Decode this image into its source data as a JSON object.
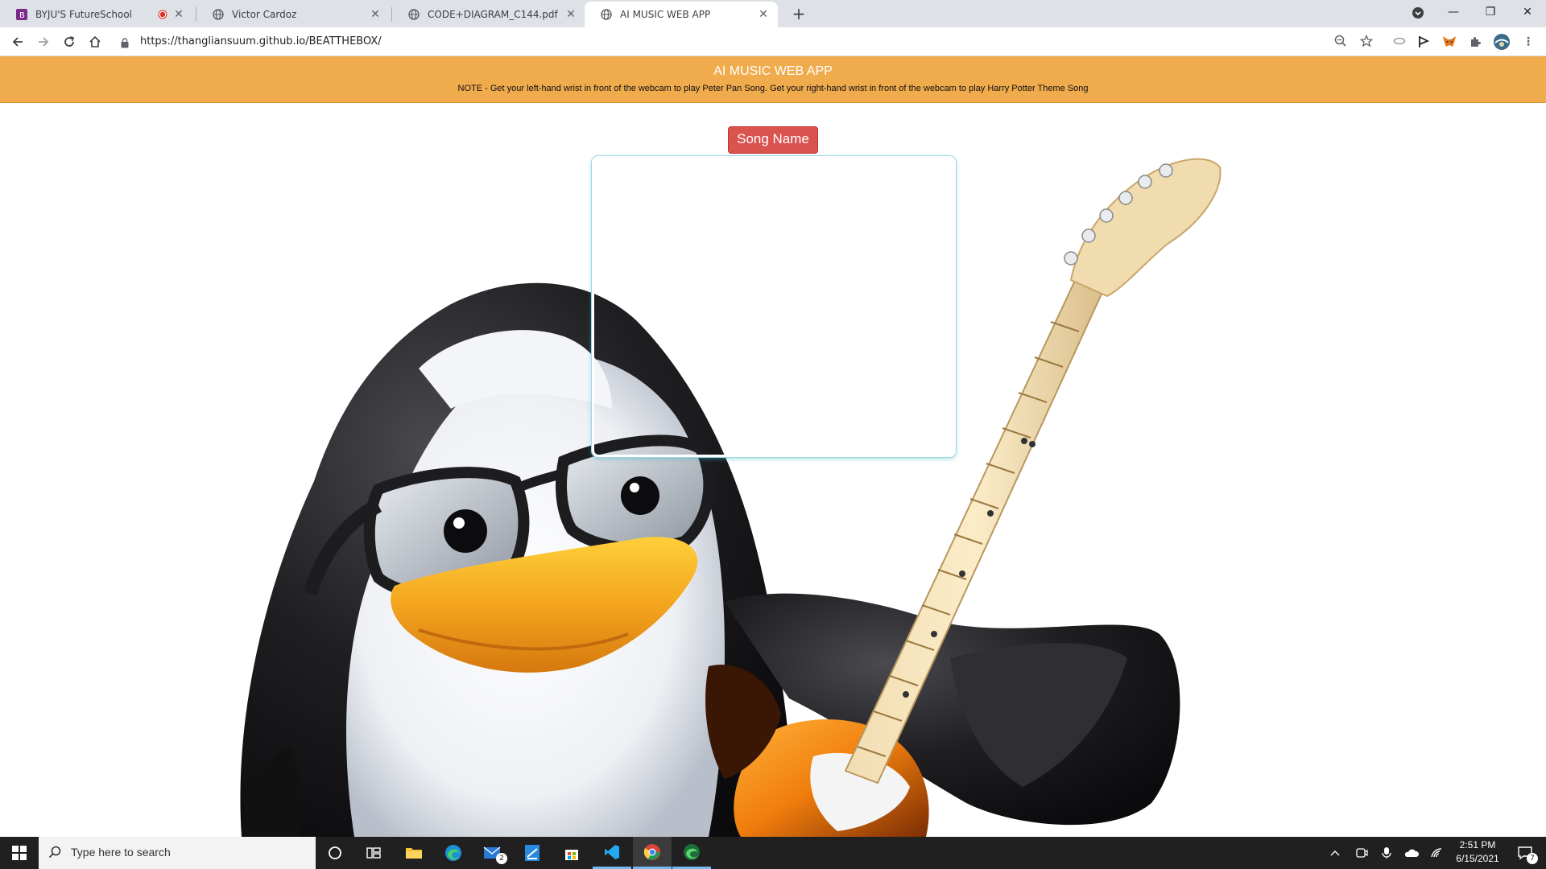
{
  "browser": {
    "tabs": [
      {
        "title": "BYJU'S FutureSchool",
        "favicon": "byjus-icon",
        "recording": true
      },
      {
        "title": "Victor Cardoz",
        "favicon": "globe-icon"
      },
      {
        "title": "CODE+DIAGRAM_C144.pdf",
        "favicon": "globe-icon"
      },
      {
        "title": "AI MUSIC WEB APP",
        "favicon": "globe-icon",
        "active": true
      }
    ],
    "url": "https://thangliansuum.github.io/BEATTHEBOX/"
  },
  "page": {
    "title": "AI MUSIC WEB APP",
    "note": "NOTE - Get your left-hand wrist in front of the webcam to play Peter Pan Song. Get your right-hand wrist in front of the webcam to play Harry Potter Theme Song",
    "song_button": "Song Name",
    "colors": {
      "banner": "#f0ab4d",
      "button": "#d9534f"
    }
  },
  "taskbar": {
    "search_placeholder": "Type here to search",
    "mail_badge": "2",
    "time": "2:51 PM",
    "date": "6/15/2021",
    "notification_count": "7"
  }
}
